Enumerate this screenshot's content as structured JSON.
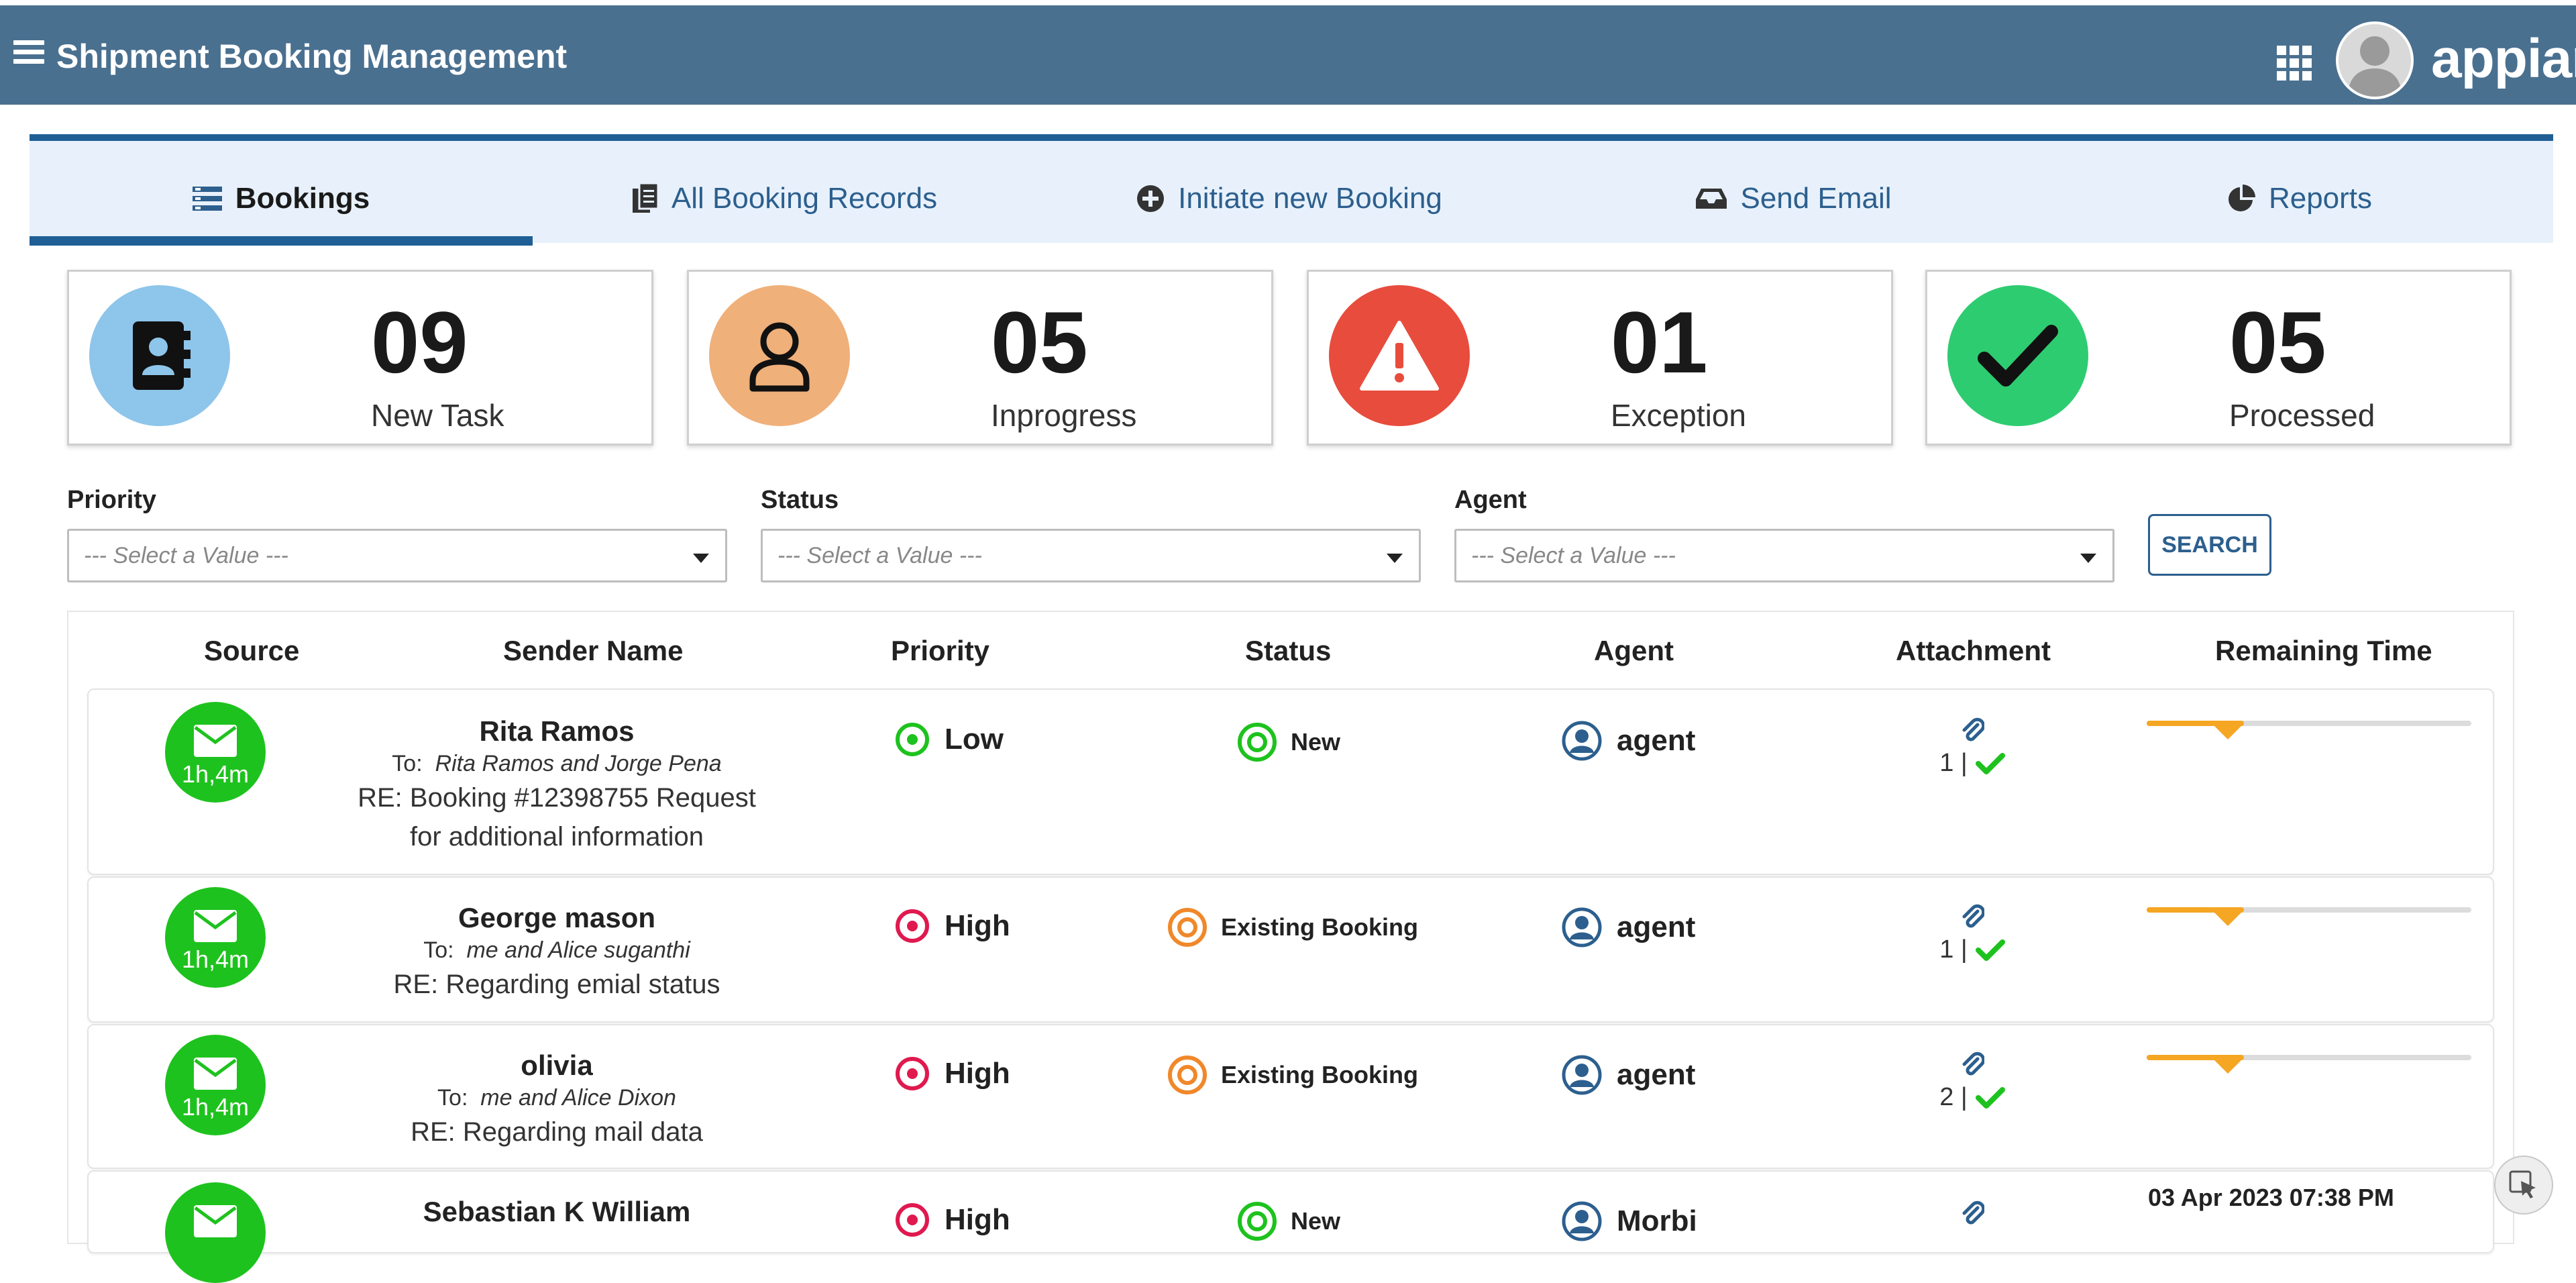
{
  "header": {
    "title": "Shipment Booking Management",
    "logo": "appian",
    "menu_icon": "hamburger-icon",
    "apps_icon": "grid-icon"
  },
  "tabs": [
    {
      "label": "Bookings",
      "icon": "list-icon",
      "active": true
    },
    {
      "label": "All Booking Records",
      "icon": "documents-icon"
    },
    {
      "label": "Initiate new Booking",
      "icon": "plus-circle-icon"
    },
    {
      "label": "Send Email",
      "icon": "inbox-icon"
    },
    {
      "label": "Reports",
      "icon": "pie-chart-icon"
    }
  ],
  "stats": [
    {
      "count": "09",
      "label": "New Task",
      "color": "#8ec5ea",
      "icon": "address-book-icon"
    },
    {
      "count": "05",
      "label": "Inprogress",
      "color": "#f0b07a",
      "icon": "user-icon"
    },
    {
      "count": "01",
      "label": "Exception",
      "color": "#e84c3d",
      "icon": "warning-icon"
    },
    {
      "count": "05",
      "label": "Processed",
      "color": "#2ecc71",
      "icon": "check-icon"
    }
  ],
  "filters": {
    "priority": {
      "label": "Priority",
      "placeholder": "--- Select a Value ---"
    },
    "status": {
      "label": "Status",
      "placeholder": "--- Select a Value ---"
    },
    "agent": {
      "label": "Agent",
      "placeholder": "--- Select a Value ---"
    },
    "search_label": "SEARCH"
  },
  "table": {
    "headers": [
      "Source",
      "Sender Name",
      "Priority",
      "Status",
      "Agent",
      "Attachment",
      "Remaining Time"
    ],
    "rows": [
      {
        "source_time": "1h,4m",
        "sender": "Rita Ramos",
        "to_prefix": "To:",
        "to": "Rita Ramos and Jorge Pena",
        "subject_line1": "RE: Booking #12398755 Request",
        "subject_line2": "for additional information",
        "priority": "Low",
        "status": "New",
        "agent": "agent",
        "attachments": "1 |",
        "remaining_progress": 0.3
      },
      {
        "source_time": "1h,4m",
        "sender": "George mason",
        "to_prefix": "To:",
        "to": "me and Alice suganthi",
        "subject_line1": "RE: Regarding emial status",
        "priority": "High",
        "status": "Existing Booking",
        "agent": "agent",
        "attachments": "1 |",
        "remaining_progress": 0.3
      },
      {
        "source_time": "1h,4m",
        "sender": "olivia",
        "to_prefix": "To:",
        "to": "me and Alice Dixon",
        "subject_line1": "RE: Regarding mail data",
        "priority": "High",
        "status": "Existing Booking",
        "agent": "agent",
        "attachments": "2 |",
        "remaining_progress": 0.3
      },
      {
        "sender": "Sebastian K William",
        "priority": "High",
        "status": "New",
        "agent": "Morbi",
        "remaining_date": "03 Apr 2023 07:38 PM"
      }
    ]
  },
  "colors": {
    "header_bg": "#4a7090",
    "accent": "#1f5f95",
    "priority_high": "#e0194e",
    "priority_low": "#1ec21e",
    "status_existing": "#f0882a",
    "status_new": "#1ec21e",
    "agent_icon": "#2c5f8e",
    "check": "#1ec21e",
    "remaining_bar": "#f5a623"
  }
}
